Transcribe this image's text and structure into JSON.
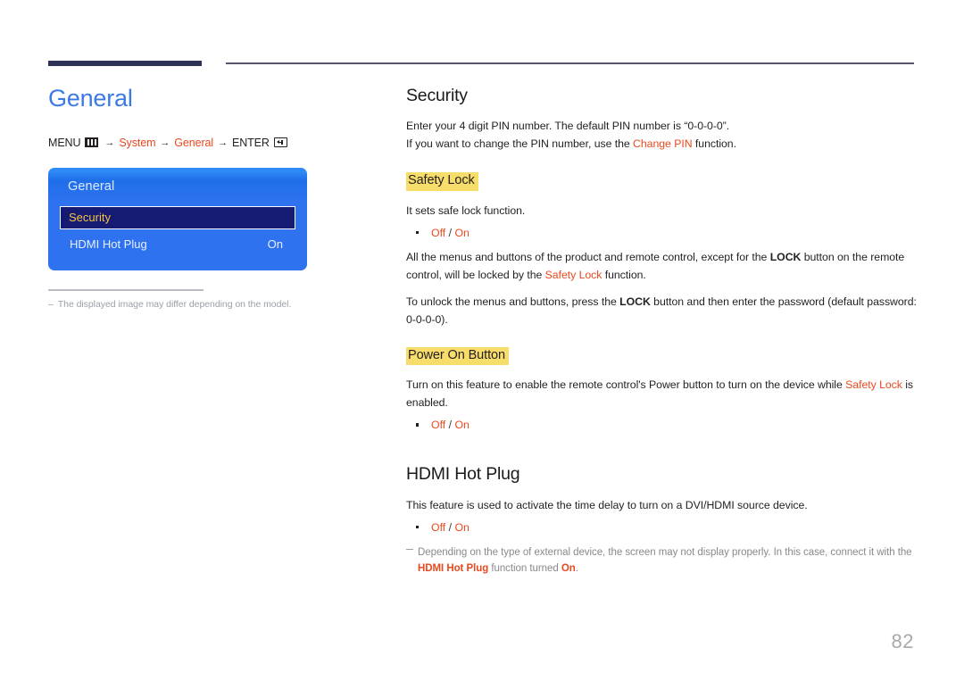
{
  "page": {
    "number": "82"
  },
  "left": {
    "title": "General",
    "breadcrumb": {
      "menu_label": "MENU",
      "menu_icon": "menu-grid-icon",
      "arrow": "→",
      "item1": "System",
      "item2": "General",
      "enter_label": "ENTER",
      "enter_icon": "enter-key-icon"
    },
    "osd": {
      "title": "General",
      "rows": [
        {
          "label": "Security",
          "value": "",
          "selected": true
        },
        {
          "label": "HDMI Hot Plug",
          "value": "On",
          "selected": false
        }
      ]
    },
    "caption": {
      "dash": "–",
      "text": "The displayed image may differ depending on the model."
    }
  },
  "right": {
    "security": {
      "heading": "Security",
      "line1": "Enter your 4 digit PIN number. The default PIN number is “0-0-0-0”.",
      "line2_pre": "If you want to change the PIN number, use the ",
      "line2_link": "Change PIN",
      "line2_post": " function."
    },
    "safety_lock": {
      "heading": "Safety Lock",
      "intro": "It sets safe lock function.",
      "option_off": "Off",
      "option_sep": " / ",
      "option_on": "On",
      "para1_a": "All the menus and buttons of the product and remote control, except for the ",
      "para1_lock": "LOCK",
      "para1_b": " button on the remote control, will be locked by the ",
      "para1_link": "Safety Lock",
      "para1_c": " function.",
      "para2_a": "To unlock the menus and buttons, press the ",
      "para2_lock": "LOCK",
      "para2_b": " button and then enter the password (default password: 0-0-0-0)."
    },
    "power_on_button": {
      "heading": "Power On Button",
      "para_a": "Turn on this feature to enable the remote control's Power button to turn on the device while ",
      "para_link": "Safety Lock",
      "para_b": " is enabled.",
      "option_off": "Off",
      "option_sep": " / ",
      "option_on": "On"
    },
    "hdmi_hot_plug": {
      "heading": "HDMI Hot Plug",
      "intro": "This feature is used to activate the time delay to turn on a DVI/HDMI source device.",
      "option_off": "Off",
      "option_sep": " / ",
      "option_on": "On",
      "note_a": "Depending on the type of external device, the screen may not display properly. In this case, connect it with the ",
      "note_link": "HDMI Hot Plug",
      "note_b": " function turned ",
      "note_on": "On",
      "note_c": "."
    }
  },
  "colors": {
    "accent_blue": "#3b7ae4",
    "accent_orange": "#e8491f",
    "highlight_yellow": "#f7dd6a",
    "rule_navy": "#2e3257",
    "osd_select_bg": "#151a72",
    "osd_select_text": "#f5c342"
  }
}
